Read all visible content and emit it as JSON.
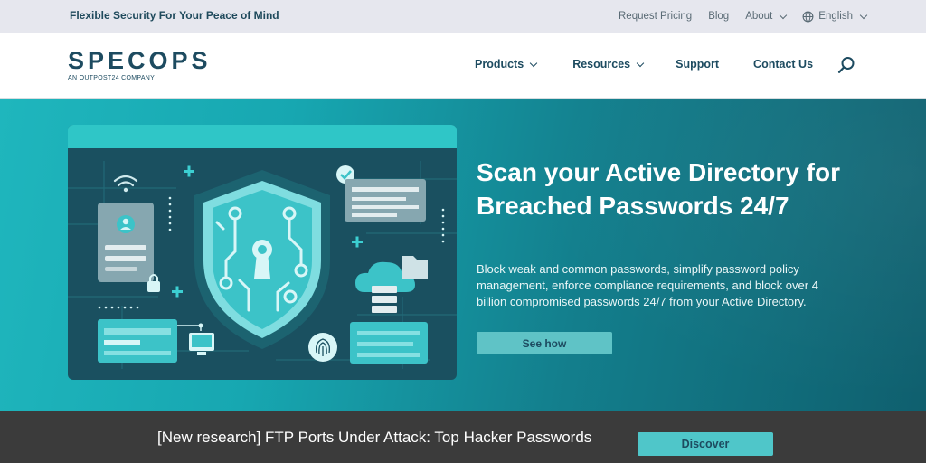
{
  "topbar": {
    "tagline": "Flexible Security For Your Peace of Mind",
    "links": {
      "request_pricing": "Request Pricing",
      "blog": "Blog",
      "about": "About",
      "language": "English"
    },
    "icons": {
      "globe": "globe-icon",
      "chevron": "chevron-down-icon"
    }
  },
  "header": {
    "logo": {
      "word": "SPECOPS",
      "subtitle": "AN OUTPOST24 COMPANY"
    },
    "nav": {
      "products": "Products",
      "resources": "Resources",
      "support": "Support",
      "contact": "Contact Us"
    },
    "search_icon": "search-icon"
  },
  "hero": {
    "title": "Scan your Active Directory for Breached Passwords 24/7",
    "description": "Block weak and common passwords, simplify password policy management, enforce compliance requirements, and block over 4 billion compromised passwords 24/7 from your Active Directory.",
    "cta_label": "See how"
  },
  "banner": {
    "text": "[New research] FTP Ports Under Attack: Top Hacker Passwords",
    "button_label": "Discover"
  },
  "colors": {
    "brand_dark": "#1d4b60",
    "accent_teal": "#2fc6c7",
    "hero_start": "#1fb6bd",
    "hero_end": "#0f5f6e",
    "banner_bg": "#3b3b3b"
  }
}
